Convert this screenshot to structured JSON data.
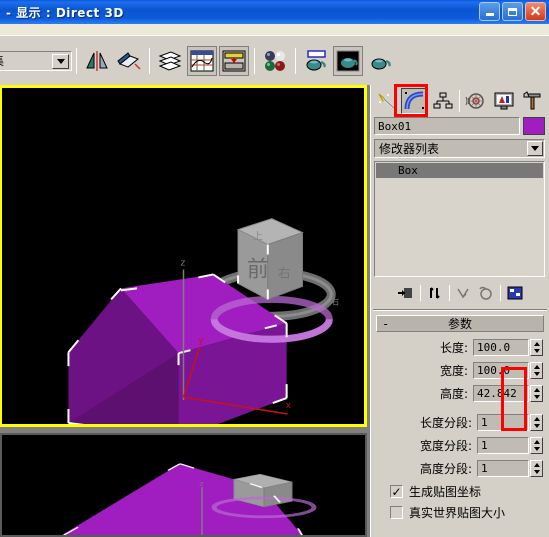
{
  "window": {
    "title": "- 显示 : Direct 3D",
    "minimize_label": "minimize",
    "maximize_label": "restore",
    "close_label": "✕"
  },
  "toolbar": {
    "set_combo_value": "集",
    "buttons": [
      {
        "name": "mirror-icon",
        "label": "镜像"
      },
      {
        "name": "align-icon",
        "label": "对齐"
      },
      {
        "name": "layer-manager-icon",
        "label": "层管理器"
      },
      {
        "name": "curve-editor-icon",
        "label": "曲线编辑器"
      },
      {
        "name": "schematic-view-icon",
        "label": "图解视图"
      },
      {
        "name": "material-editor-icon",
        "label": "材质编辑器"
      },
      {
        "name": "render-setup-icon",
        "label": "渲染设置"
      },
      {
        "name": "rendered-frame-icon",
        "label": "渲染帧窗口"
      },
      {
        "name": "render-production-icon",
        "label": "渲染产品"
      }
    ]
  },
  "command_panel": {
    "tabs": [
      {
        "name": "create-tab",
        "label": "创建",
        "active": false
      },
      {
        "name": "modify-tab",
        "label": "修改",
        "active": true
      },
      {
        "name": "hierarchy-tab",
        "label": "层次",
        "active": false
      },
      {
        "name": "motion-tab",
        "label": "运动",
        "active": false
      },
      {
        "name": "display-tab",
        "label": "显示",
        "active": false
      },
      {
        "name": "utilities-tab",
        "label": "工具",
        "active": false
      }
    ],
    "object_name": "Box01",
    "object_color": "#a01ec0",
    "modifier_list_label": "修改器列表",
    "stack": [
      {
        "label": "Box",
        "selected": true
      }
    ],
    "stack_tools": [
      {
        "name": "pin-stack-icon",
        "label": "固定堆栈"
      },
      {
        "name": "show-end-result-icon",
        "label": "显示最终结果"
      },
      {
        "name": "make-unique-icon",
        "label": "使唯一"
      },
      {
        "name": "remove-modifier-icon",
        "label": "从堆栈中移除修改器"
      },
      {
        "name": "configure-sets-icon",
        "label": "配置修改器集"
      }
    ],
    "rollout": {
      "collapse_glyph": "-",
      "title": "参数"
    },
    "parameters": [
      {
        "name": "length",
        "label": "长度:",
        "value": "100.0"
      },
      {
        "name": "width",
        "label": "宽度:",
        "value": "100.0"
      },
      {
        "name": "height",
        "label": "高度:",
        "value": "42.842"
      }
    ],
    "segments": [
      {
        "name": "length-segs",
        "label": "长度分段:",
        "value": "1"
      },
      {
        "name": "width-segs",
        "label": "宽度分段:",
        "value": "1"
      },
      {
        "name": "height-segs",
        "label": "高度分段:",
        "value": "1"
      }
    ],
    "checkboxes": [
      {
        "name": "generate-mapping-coords",
        "label": "生成贴图坐标",
        "checked": true,
        "mark": "✓"
      },
      {
        "name": "real-world-map-size",
        "label": "真实世界贴图大小",
        "checked": false,
        "mark": ""
      }
    ]
  },
  "viewport": {
    "active_border_color": "#ffff00",
    "background": "#000000",
    "object_color": "#a01ec0",
    "object_shade_dark": "#5d1070",
    "object_shade_mid": "#7a1595",
    "selection_color": "#ffffff",
    "viewcube_front_label": "前",
    "viewcube_top_label": "上",
    "viewcube_right_label": "右",
    "gizmo": {
      "x_label": "x",
      "y_label": "y",
      "z_label": "z",
      "x_color": "#cc0000",
      "y_color": "#cc0000",
      "z_color": "#888888"
    }
  },
  "annotations": [
    {
      "name": "modify-tab-highlight"
    },
    {
      "name": "spinner-highlight"
    }
  ]
}
